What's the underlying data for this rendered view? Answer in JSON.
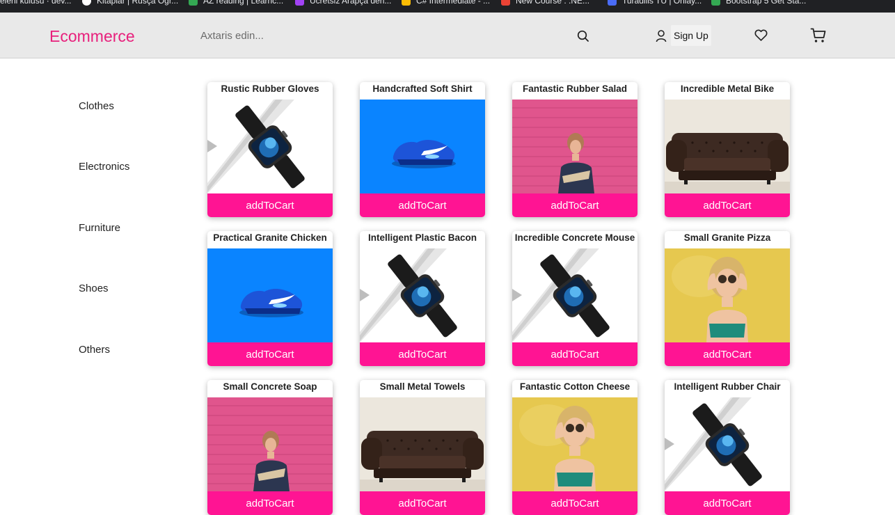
{
  "bookmarks": [
    {
      "label": "elerii kulusu · dev...",
      "color": "#f28b82"
    },
    {
      "label": "Kitaplar | Rusça Ogr...",
      "color": "#ffffff"
    },
    {
      "label": "AZ reading | Learnc...",
      "color": "#34a853"
    },
    {
      "label": "Ucretsiz Arapça derl...",
      "color": "#a142f4"
    },
    {
      "label": "C# Intermediate - ...",
      "color": "#fbbc04"
    },
    {
      "label": "New Course : .NE...",
      "color": "#ea4335"
    },
    {
      "label": "Turadilis TU | Onlay...",
      "color": "#4a6cf7"
    },
    {
      "label": "Bootstrap 5 Get Sta...",
      "color": "#34a853"
    }
  ],
  "header": {
    "brand": "Ecommerce",
    "search_placeholder": "Axtaris edin...",
    "signup_label": "Sign Up",
    "brand_color": "#e8207c"
  },
  "sidebar": {
    "categories": [
      "Clothes",
      "Electronics",
      "Furniture",
      "Shoes",
      "Others"
    ]
  },
  "products": [
    {
      "name": "Rustic Rubber Gloves",
      "image": "watch",
      "button": "addToCart"
    },
    {
      "name": "Handcrafted Soft Shirt",
      "image": "sneaker",
      "button": "addToCart"
    },
    {
      "name": "Fantastic Rubber Salad",
      "image": "woman-pink-wall",
      "button": "addToCart"
    },
    {
      "name": "Incredible Metal Bike",
      "image": "leather-sofa",
      "button": "addToCart"
    },
    {
      "name": "Practical Granite Chicken",
      "image": "sneaker",
      "button": "addToCart"
    },
    {
      "name": "Intelligent Plastic Bacon",
      "image": "watch",
      "button": "addToCart"
    },
    {
      "name": "Incredible Concrete Mouse",
      "image": "watch",
      "button": "addToCart"
    },
    {
      "name": "Small Granite Pizza",
      "image": "woman-sunglasses",
      "button": "addToCart"
    },
    {
      "name": "Small Concrete Soap",
      "image": "woman-pink-wall",
      "button": "addToCart"
    },
    {
      "name": "Small Metal Towels",
      "image": "leather-sofa",
      "button": "addToCart"
    },
    {
      "name": "Fantastic Cotton Cheese",
      "image": "woman-sunglasses",
      "button": "addToCart"
    },
    {
      "name": "Intelligent Rubber Chair",
      "image": "watch",
      "button": "addToCart"
    }
  ],
  "accent_color": "#ff1493"
}
